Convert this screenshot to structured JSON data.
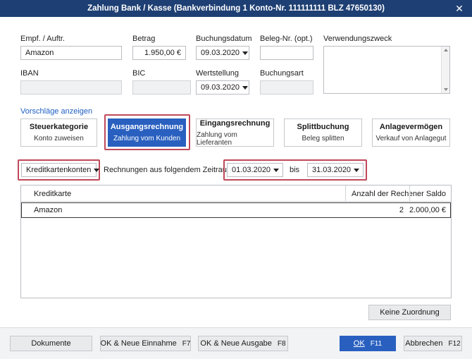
{
  "window": {
    "title": "Zahlung Bank / Kasse (Bankverbindung 1 Konto-Nr. 111111111  BLZ 47650130)",
    "close": "✕"
  },
  "form": {
    "empf_label": "Empf. / Auftr.",
    "empf_value": "Amazon",
    "betrag_label": "Betrag",
    "betrag_value": "1.950,00 €",
    "buchungsdatum_label": "Buchungsdatum",
    "buchungsdatum_value": "09.03.2020",
    "beleg_label": "Beleg-Nr. (opt.)",
    "beleg_value": "",
    "verwendungszweck_label": "Verwendungszweck",
    "verwendungszweck_value": "",
    "iban_label": "IBAN",
    "iban_value": "",
    "bic_label": "BIC",
    "bic_value": "",
    "wertstellung_label": "Wertstellung",
    "wertstellung_value": "09.03.2020",
    "buchungsart_label": "Buchungsart",
    "buchungsart_value": ""
  },
  "suggestions_link": "Vorschläge anzeigen",
  "tiles": [
    {
      "title": "Steuerkategorie",
      "subtitle": "Konto zuweisen"
    },
    {
      "title": "Ausgangsrechnung",
      "subtitle": "Zahlung vom Kunden"
    },
    {
      "title": "Eingangsrechnung",
      "subtitle": "Zahlung vom Lieferanten"
    },
    {
      "title": "Splittbuchung",
      "subtitle": "Beleg splitten"
    },
    {
      "title": "Anlagevermögen",
      "subtitle": "Verkauf von Anlagegut"
    }
  ],
  "filter": {
    "account_type": "Kreditkartenkonten",
    "period_label": "Rechnungen aus folgendem Zeitraum",
    "from_date": "01.03.2020",
    "bis_label": "bis",
    "to_date": "31.03.2020"
  },
  "table": {
    "columns": [
      "Kreditkarte",
      "Anzahl der Rechnu",
      "Offener Saldo"
    ],
    "rows": [
      {
        "name": "Amazon",
        "count": "2",
        "saldo": "2.000,00 €"
      }
    ]
  },
  "buttons": {
    "keine_zuordnung": "Keine Zuordnung",
    "dokumente": "Dokumente",
    "neue_einnahme": "OK & Neue Einnahme",
    "neue_einnahme_key": "F7",
    "neue_ausgabe": "OK & Neue Ausgabe",
    "neue_ausgabe_key": "F8",
    "ok": "OK",
    "ok_key": "F11",
    "abbrechen": "Abbrechen",
    "abbrechen_key": "F12"
  },
  "colors": {
    "titlebar": "#1e3f73",
    "accent": "#2960c0",
    "highlight_box": "#c0485a",
    "link": "#1f5fc4"
  }
}
